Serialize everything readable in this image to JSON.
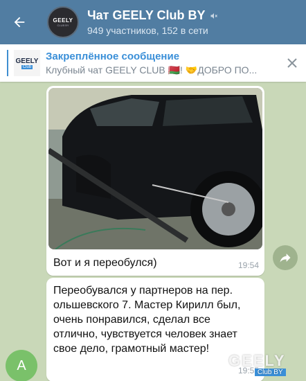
{
  "header": {
    "title": "Чат GEELY Club BY",
    "subtitle": "949 участников, 152 в сети",
    "avatar_brand": "GEELY",
    "avatar_sub": "CLUB BY"
  },
  "pinned": {
    "label": "Закреплённое сообщение",
    "text": "Клубный чат GEELY CLUB 🇧🇾! 🤝ДОБРО ПО...",
    "thumb_brand": "GEELY",
    "thumb_sub": "Club"
  },
  "messages": [
    {
      "caption": "Вот и я переобулся)",
      "time": "19:54"
    },
    {
      "text": "Переобувался у партнеров на пер. ольшевского 7. Мастер Кирилл был, очень понравился, сделал все отлично, чувствуется человек знает свое дело, грамотный мастер!",
      "time": "19:55"
    }
  ],
  "user_avatar_letter": "A",
  "watermark": {
    "brand": "GEELY",
    "sub": "Club BY"
  },
  "icons": [
    "back-arrow-icon",
    "mute-icon",
    "close-icon",
    "share-icon"
  ]
}
